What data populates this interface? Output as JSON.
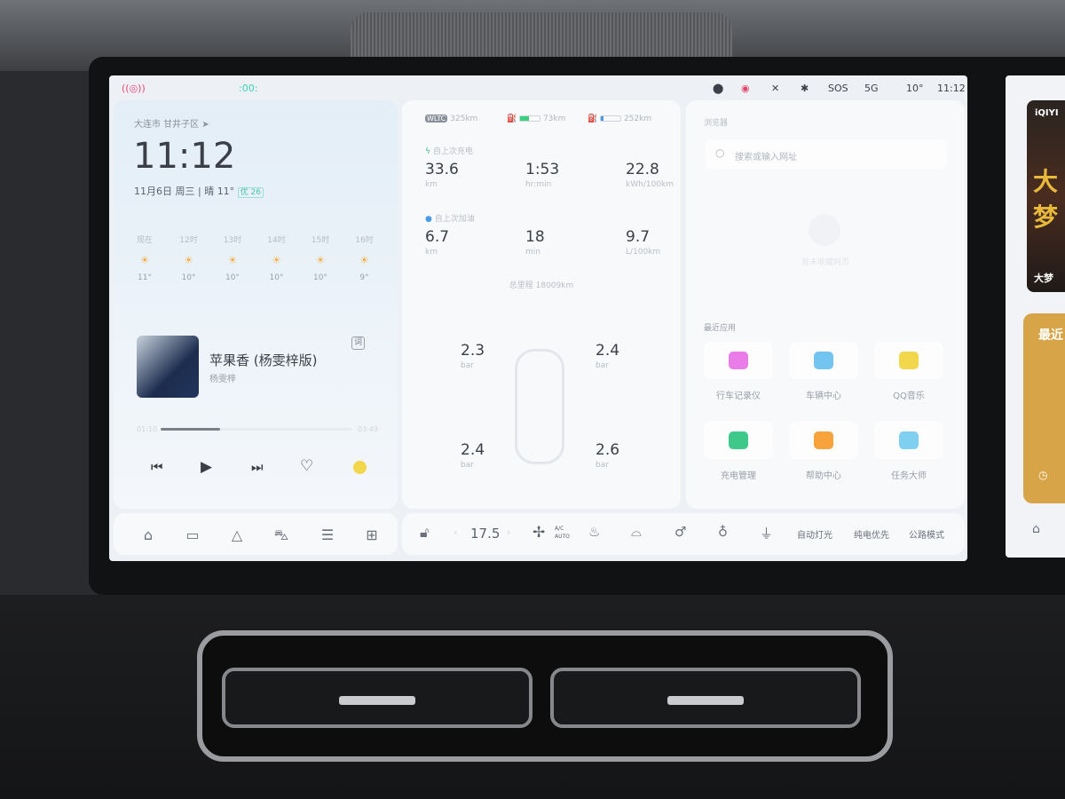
{
  "status_bar": {
    "left_icons": [
      "dashcam-recording-icon",
      "driver-monitor-icon"
    ],
    "right": [
      "location-icon",
      "record-icon",
      "mute-icon",
      "bluetooth-icon"
    ],
    "sos": "SOS",
    "network": "5G",
    "temperature": "10°",
    "time": "11:12"
  },
  "weather": {
    "location": "大连市 甘井子区",
    "time": "11:12",
    "date_line": "11月6日 周三 | 晴 11°",
    "aqi": "优 26",
    "hourly": [
      {
        "label": "现在",
        "temp": "11°"
      },
      {
        "label": "12时",
        "temp": "10°"
      },
      {
        "label": "13时",
        "temp": "10°"
      },
      {
        "label": "14时",
        "temp": "10°"
      },
      {
        "label": "15时",
        "temp": "10°"
      },
      {
        "label": "16时",
        "temp": "9°"
      }
    ]
  },
  "music": {
    "title": "苹果香 (杨雯梓版)",
    "artist": "杨雯梓",
    "lyrics_button": "词",
    "elapsed": "01:10",
    "duration": "03:49",
    "progress": 0.31
  },
  "trip": {
    "wltc_badge": "WLTC",
    "wltc_range": "325km",
    "ev_range": "73km",
    "ev_level": 0.45,
    "fuel_range": "252km",
    "fuel_level": 0.15,
    "charge_section": "自上次充电",
    "charge_metrics": [
      {
        "v": "33.6",
        "u": "km"
      },
      {
        "v": "1:53",
        "u": "hr:min"
      },
      {
        "v": "22.8",
        "u": "kWh/100km"
      }
    ],
    "fuel_section": "自上次加油",
    "fuel_metrics": [
      {
        "v": "6.7",
        "u": "km"
      },
      {
        "v": "18",
        "u": "min"
      },
      {
        "v": "9.7",
        "u": "L/100km"
      }
    ],
    "odometer": "总里程  18009km"
  },
  "tires": {
    "unit": "bar",
    "fl": "2.3",
    "fr": "2.4",
    "rl": "2.4",
    "rr": "2.6"
  },
  "browser": {
    "title": "浏览器",
    "search_placeholder": "搜索或输入网址",
    "empty": "暂未收藏网页"
  },
  "recent_apps": {
    "title": "最近应用",
    "apps": [
      {
        "label": "行车记录仪",
        "icon": "dashcam-icon",
        "color": "#e97ce8"
      },
      {
        "label": "车辆中心",
        "icon": "car-icon",
        "color": "#74c4f2"
      },
      {
        "label": "QQ音乐",
        "icon": "qq-music-icon",
        "color": "#f2d64b"
      },
      {
        "label": "充电管理",
        "icon": "battery-charge-icon",
        "color": "#3ec88a"
      },
      {
        "label": "帮助中心",
        "icon": "help-icon",
        "color": "#f7a23b"
      },
      {
        "label": "任务大师",
        "icon": "layers-icon",
        "color": "#7fd0f0"
      }
    ]
  },
  "climate": {
    "temp": "17.5",
    "ac_top": "A/C",
    "ac_bottom": "AUTO",
    "auto_light": "自动灯光",
    "ev_priority": "纯电优先",
    "road_mode": "公路模式"
  },
  "side_screen": {
    "brand": "iQIYI",
    "poster_title": "大梦",
    "recent": "最近"
  }
}
